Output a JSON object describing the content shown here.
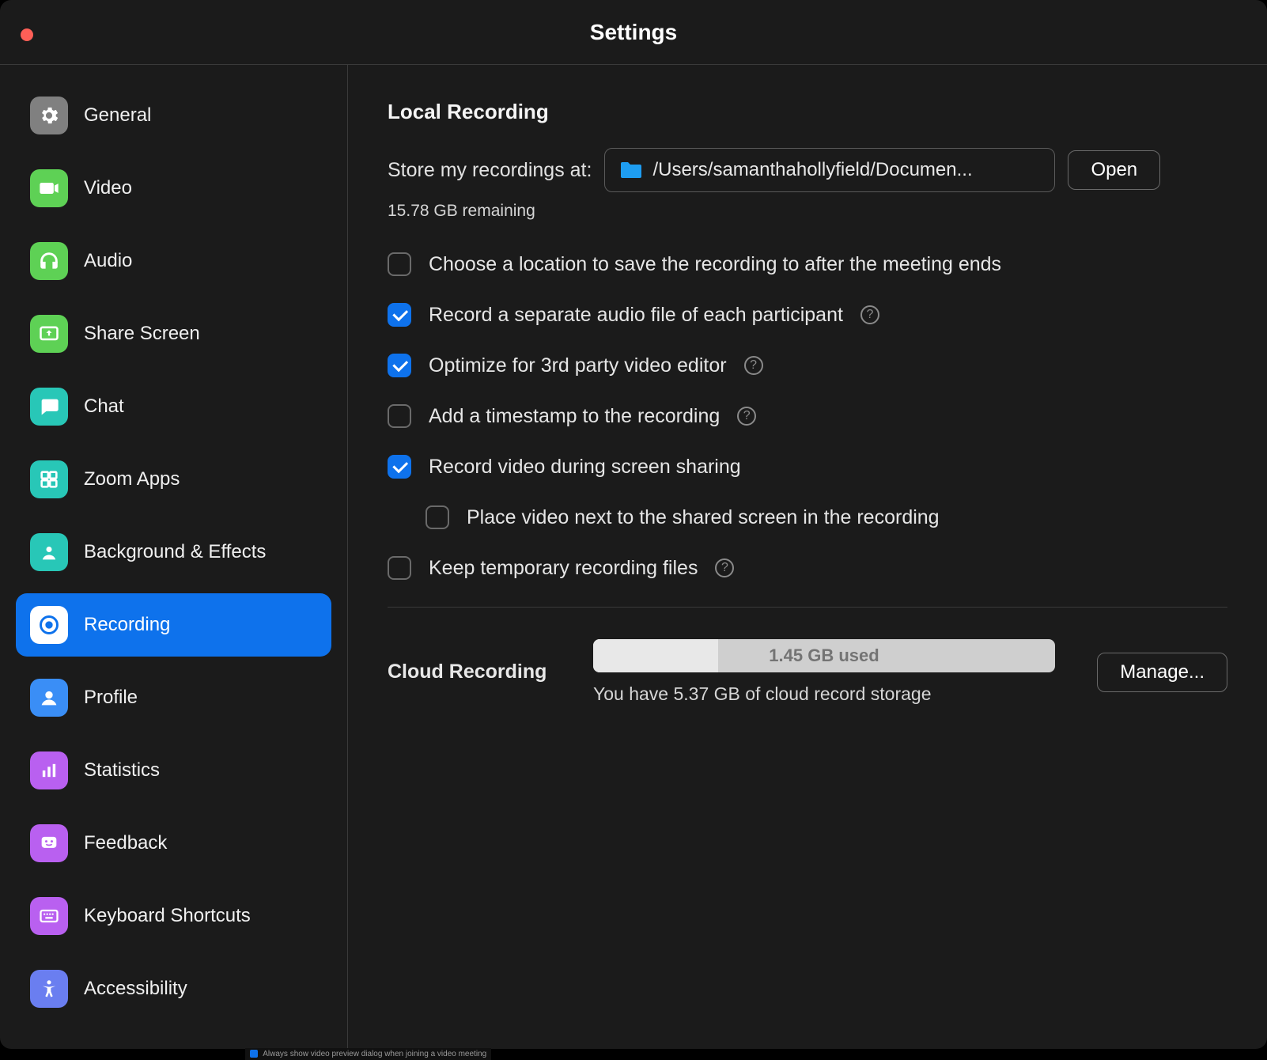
{
  "window": {
    "title": "Settings"
  },
  "sidebar": {
    "items": [
      {
        "label": "General"
      },
      {
        "label": "Video"
      },
      {
        "label": "Audio"
      },
      {
        "label": "Share Screen"
      },
      {
        "label": "Chat"
      },
      {
        "label": "Zoom Apps"
      },
      {
        "label": "Background & Effects"
      },
      {
        "label": "Recording"
      },
      {
        "label": "Profile"
      },
      {
        "label": "Statistics"
      },
      {
        "label": "Feedback"
      },
      {
        "label": "Keyboard Shortcuts"
      },
      {
        "label": "Accessibility"
      }
    ],
    "active_index": 7
  },
  "local_recording": {
    "heading": "Local Recording",
    "store_label": "Store my recordings at:",
    "path": "/Users/samanthahollyfield/Documen...",
    "open_btn": "Open",
    "remaining": "15.78 GB remaining",
    "options": [
      {
        "label": "Choose a location to save the recording to after the meeting ends",
        "checked": false,
        "help": false
      },
      {
        "label": "Record a separate audio file of each participant",
        "checked": true,
        "help": true
      },
      {
        "label": "Optimize for 3rd party video editor",
        "checked": true,
        "help": true
      },
      {
        "label": "Add a timestamp to the recording",
        "checked": false,
        "help": true
      },
      {
        "label": "Record video during screen sharing",
        "checked": true,
        "help": false
      },
      {
        "label": "Place video next to the shared screen in the recording",
        "checked": false,
        "help": false,
        "indented": true
      },
      {
        "label": "Keep temporary recording files",
        "checked": false,
        "help": true
      }
    ]
  },
  "cloud_recording": {
    "heading": "Cloud Recording",
    "used_label": "1.45 GB used",
    "used_percent": 27,
    "note": "You have 5.37 GB of cloud record storage",
    "manage_btn": "Manage..."
  },
  "below_strip": {
    "text": "Always show video preview dialog when joining a video meeting"
  },
  "colors": {
    "accent": "#0e72ec",
    "icon_general": "#808080",
    "icon_video": "#5ed155",
    "icon_audio": "#5ed155",
    "icon_share": "#5ed155",
    "icon_chat": "#28c7b7",
    "icon_apps": "#28c7b7",
    "icon_bg": "#28c7b7",
    "icon_recording": "#ffffff",
    "icon_profile": "#3a8ef6",
    "icon_stats": "#b960f0",
    "icon_feedback": "#b960f0",
    "icon_keyboard": "#b960f0",
    "icon_a11y": "#6a7ef0"
  }
}
